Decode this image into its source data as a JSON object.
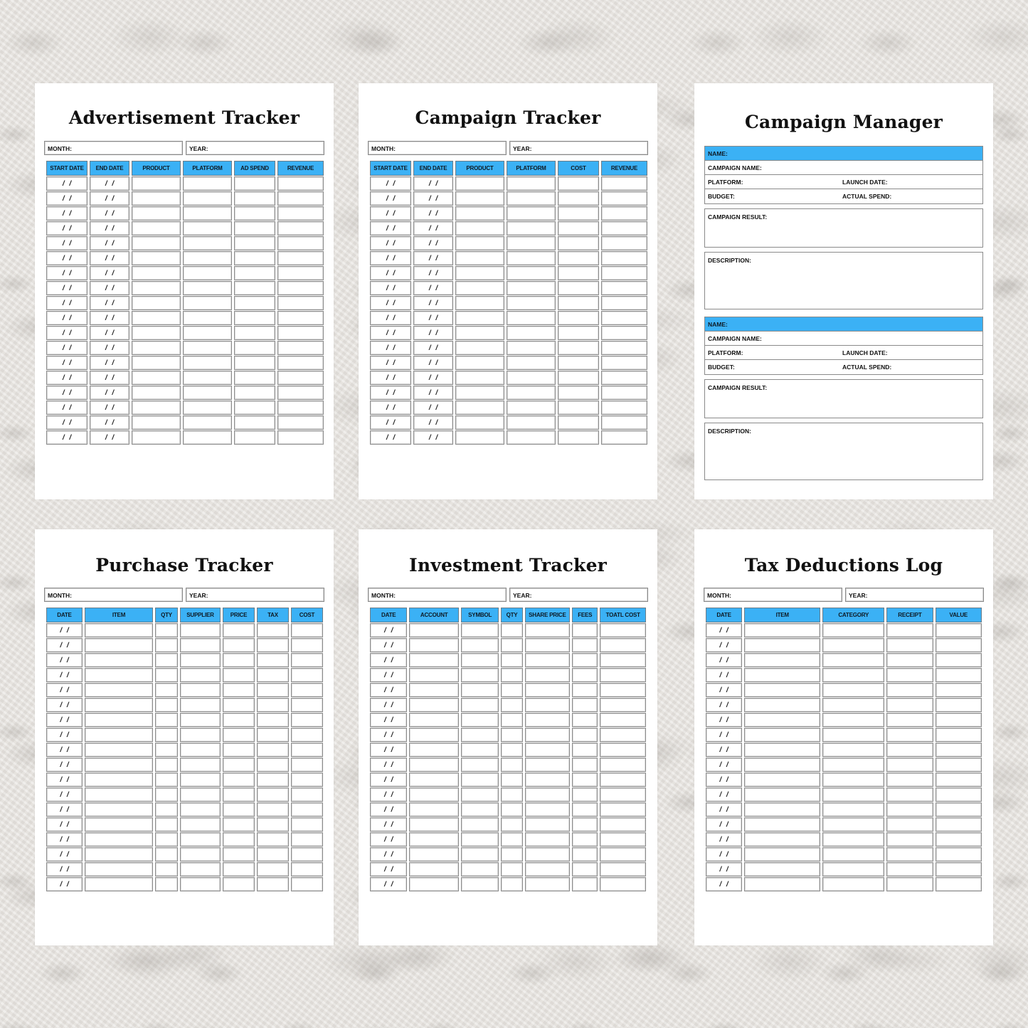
{
  "pages": {
    "advertisement_tracker": {
      "title": "Advertisement Tracker",
      "month_label": "MONTH:",
      "year_label": "YEAR:",
      "columns": [
        "START DATE",
        "END DATE",
        "PRODUCT",
        "PLATFORM",
        "AD SPEND",
        "REVENUE"
      ],
      "row_count": 18,
      "date_placeholder": "/ /"
    },
    "campaign_tracker": {
      "title": "Campaign Tracker",
      "month_label": "MONTH:",
      "year_label": "YEAR:",
      "columns": [
        "START DATE",
        "END DATE",
        "PRODUCT",
        "PLATFORM",
        "COST",
        "REVENUE"
      ],
      "row_count": 18,
      "date_placeholder": "/ /"
    },
    "campaign_manager": {
      "title": "Campaign Manager",
      "blocks": [
        {
          "name_label": "NAME:",
          "campaign_name_label": "CAMPAIGN NAME:",
          "platform_label": "PLATFORM:",
          "launch_date_label": "LAUNCH DATE:",
          "budget_label": "BUDGET:",
          "actual_spend_label": "ACTUAL SPEND:",
          "campaign_result_label": "CAMPAIGN RESULT:",
          "description_label": "DESCRIPTION:"
        },
        {
          "name_label": "NAME:",
          "campaign_name_label": "CAMPAIGN NAME:",
          "platform_label": "PLATFORM:",
          "launch_date_label": "LAUNCH DATE:",
          "budget_label": "BUDGET:",
          "actual_spend_label": "ACTUAL SPEND:",
          "campaign_result_label": "CAMPAIGN RESULT:",
          "description_label": "DESCRIPTION:"
        }
      ]
    },
    "purchase_tracker": {
      "title": "Purchase Tracker",
      "month_label": "MONTH:",
      "year_label": "YEAR:",
      "columns": [
        "DATE",
        "ITEM",
        "QTY",
        "SUPPLIER",
        "PRICE",
        "TAX",
        "COST"
      ],
      "row_count": 18,
      "date_placeholder": "/ /"
    },
    "investment_tracker": {
      "title": "Investment Tracker",
      "month_label": "MONTH:",
      "year_label": "YEAR:",
      "columns": [
        "DATE",
        "ACCOUNT",
        "SYMBOL",
        "QTY",
        "SHARE PRICE",
        "FEES",
        "TOATL COST"
      ],
      "row_count": 18,
      "date_placeholder": "/ /"
    },
    "tax_deductions_log": {
      "title": "Tax Deductions Log",
      "month_label": "MONTH:",
      "year_label": "YEAR:",
      "columns": [
        "DATE",
        "ITEM",
        "CATEGORY",
        "RECEIPT",
        "VALUE"
      ],
      "row_count": 18,
      "date_placeholder": "/ /"
    }
  },
  "colors": {
    "header_blue": "#3bb1f5",
    "page_white": "#ffffff",
    "background_stone": "#e6e3df"
  }
}
